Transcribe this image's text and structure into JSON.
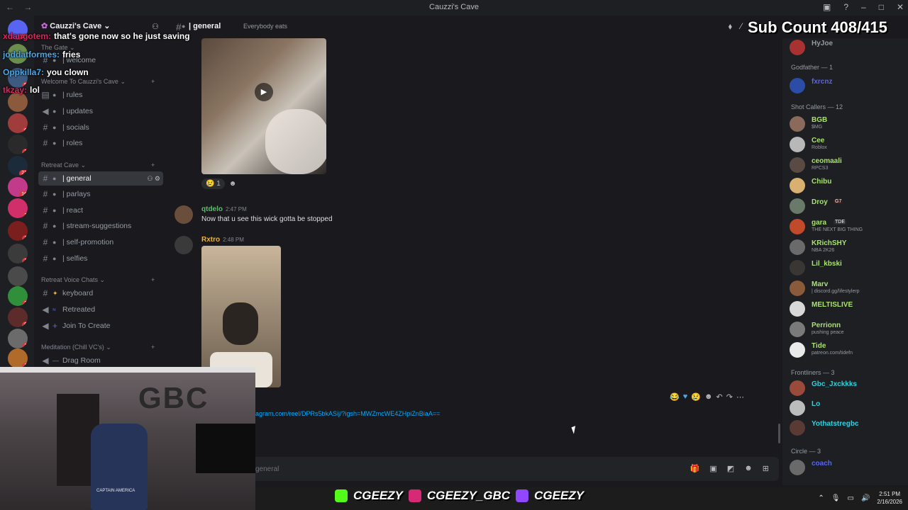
{
  "window": {
    "title": "Cauzzi's Cave",
    "nav_back": "←",
    "nav_fwd": "→"
  },
  "server": {
    "name": "Cauzzi's Cave"
  },
  "server_badges": [
    "24",
    "",
    "5",
    "",
    "6",
    "1",
    "21",
    "16",
    "1",
    "1",
    "1",
    "",
    "2",
    "8",
    "1",
    "",
    "1"
  ],
  "categories": {
    "gate": "The Gate",
    "welcome": "Welcome To Cauzzi's Cave",
    "retreat": "Retreat Cave",
    "voice": "Retreat Voice Chats",
    "meditation": "Meditation (Chill VC's)"
  },
  "channels": {
    "welcome": "| welcome",
    "rules": "| rules",
    "updates": "| updates",
    "socials": "| socials",
    "roles": "| roles",
    "general": "| general",
    "parlays": "| parlays",
    "react": "| react",
    "stream_suggestions": "| stream-suggestions",
    "self_promotion": "| self-promotion",
    "selfies": "| selfies",
    "keyboard": "keyboard",
    "retreated": "Retreated",
    "join_to_create": "Join To Create",
    "drag_room": "Drag Room"
  },
  "header": {
    "channel": "| general",
    "topic": "Everybody eats"
  },
  "messages": [
    {
      "user": "qtdelo",
      "time": "2:47 PM",
      "text": "Now that u see this wick gotta be stopped",
      "color": "#5cbc6c"
    },
    {
      "user": "Rxtro",
      "time": "2:48 PM",
      "text": "",
      "color": "#f0b232"
    }
  ],
  "reaction": {
    "count": "1"
  },
  "link": "agram.com/reel/DPRs5bkASij/?igsh=MWZmcWE4ZHpiZnBiaA==",
  "composer": {
    "placeholder": "general"
  },
  "member_roles": {
    "godfather": "Godfather — 1",
    "shot_callers": "Shot Callers — 12",
    "frontliners": "Frontliners — 3",
    "circle": "Circle — 3"
  },
  "members_top": [
    {
      "name": "HyJoe",
      "status": ""
    },
    {
      "name": "fxrcnz",
      "status": ""
    }
  ],
  "shot_callers": [
    {
      "name": "BGB",
      "status": "$MG"
    },
    {
      "name": "Cee",
      "status": "Roblox"
    },
    {
      "name": "ceomaali",
      "status": "RPCS3"
    },
    {
      "name": "Chibu",
      "status": ""
    },
    {
      "name": "Droy",
      "status": "",
      "tag": "G7"
    },
    {
      "name": "gara",
      "status": "THE NEXT BIG THING",
      "tag": "TDE"
    },
    {
      "name": "KRichSHY",
      "status": "NBA 2K26"
    },
    {
      "name": "Lil_kbski",
      "status": ""
    },
    {
      "name": "Marv",
      "status": "| discord.gg/lifestylerp"
    },
    {
      "name": "MELTISLIVE",
      "status": ""
    },
    {
      "name": "Perrionn",
      "status": "pushing peace"
    },
    {
      "name": "Tide",
      "status": "patreon.com/tidefn"
    }
  ],
  "frontliners": [
    {
      "name": "Gbc_Jxckkks",
      "status": ""
    },
    {
      "name": "Lo",
      "status": ""
    },
    {
      "name": "Yothatstregbc",
      "status": ""
    }
  ],
  "circle": [
    {
      "name": "coach",
      "status": ""
    }
  ],
  "overlay_chat": [
    {
      "user": "xdangotem:",
      "text": "that's gone now so he just saving",
      "color": "#e0245e"
    },
    {
      "user": "joddatformes:",
      "text": "fries",
      "color": "#4aa8e8"
    },
    {
      "user": "Oppkilla7:",
      "text": "you clown",
      "color": "#4aa8e8"
    },
    {
      "user": "tkzay:",
      "text": "lol",
      "color": "#e0245e"
    }
  ],
  "sub_count": "Sub Count 408/415",
  "webcam": {
    "sign": "GBC",
    "chair_text": "CAPTAIN AMERICA"
  },
  "banner": {
    "kick": "CGEEZY",
    "instagram": "CGEEZY_GBC",
    "twitch": "CGEEZY"
  },
  "clock": {
    "time": "2:51 PM",
    "date": "2/16/2026"
  },
  "colors": {
    "accent": "#5865f2",
    "background": "#1a1a1e",
    "online": "#23a55a"
  }
}
